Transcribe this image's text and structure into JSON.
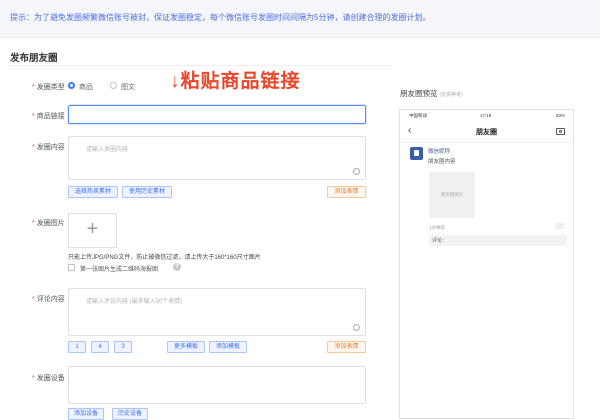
{
  "notice": {
    "text": "提示：为了避免发圈频繁微信账号被封，保证发圈稳定，每个微信账号发圈时间间隔为5分钟，请创建合理的发圈计划。"
  },
  "section": {
    "title": "发布朋友圈"
  },
  "form": {
    "type": {
      "label": "发圈类型",
      "options": [
        {
          "label": "商品",
          "selected": true
        },
        {
          "label": "图文",
          "selected": false
        }
      ]
    },
    "link": {
      "label": "商品链接"
    },
    "content": {
      "label": "发圈内容",
      "placeholder": "请输入发圈内容",
      "buttons": {
        "hot_material": "选择热卖素材",
        "history_material": "使用历史素材",
        "add_emoji": "添加表情"
      }
    },
    "image": {
      "label": "发圈图片",
      "plus": "+",
      "hint": "只能上传JPG/PNG文件，防止被微信过滤，请上传大于160*160尺寸图片",
      "qr_checkbox_label": "第一张图片生成二维码海报图",
      "help": "?"
    },
    "comment": {
      "label": "评论内容",
      "placeholder": "请输入评论内容 (最多输入50个表情)",
      "chips": [
        "1",
        "4",
        "3"
      ],
      "buttons": {
        "more_templates": "更多模板",
        "add_template": "添加模板",
        "add_emoji": "添加表情"
      }
    },
    "device": {
      "label": "发圈设备",
      "buttons": {
        "add_device": "添加设备",
        "history_device": "历史设备"
      }
    }
  },
  "annotation": {
    "text": "↓粘贴商品链接",
    "color": "#e8472a"
  },
  "preview": {
    "title": "朋友圈预览",
    "subtitle": "(仅供参考)",
    "status": {
      "carrier": "中国移动",
      "time": "17:18",
      "battery": "83%"
    },
    "nav_title": "朋友圈",
    "back": "‹",
    "nickname": "微信昵称",
    "post_text": "朋友圈内容",
    "image_placeholder": "朋友圈图片",
    "time": "1分钟前",
    "comment": "评论："
  },
  "colors": {
    "accent": "#3a7afe",
    "notice_text": "#4a6ee0",
    "warn": "#e8802e"
  }
}
